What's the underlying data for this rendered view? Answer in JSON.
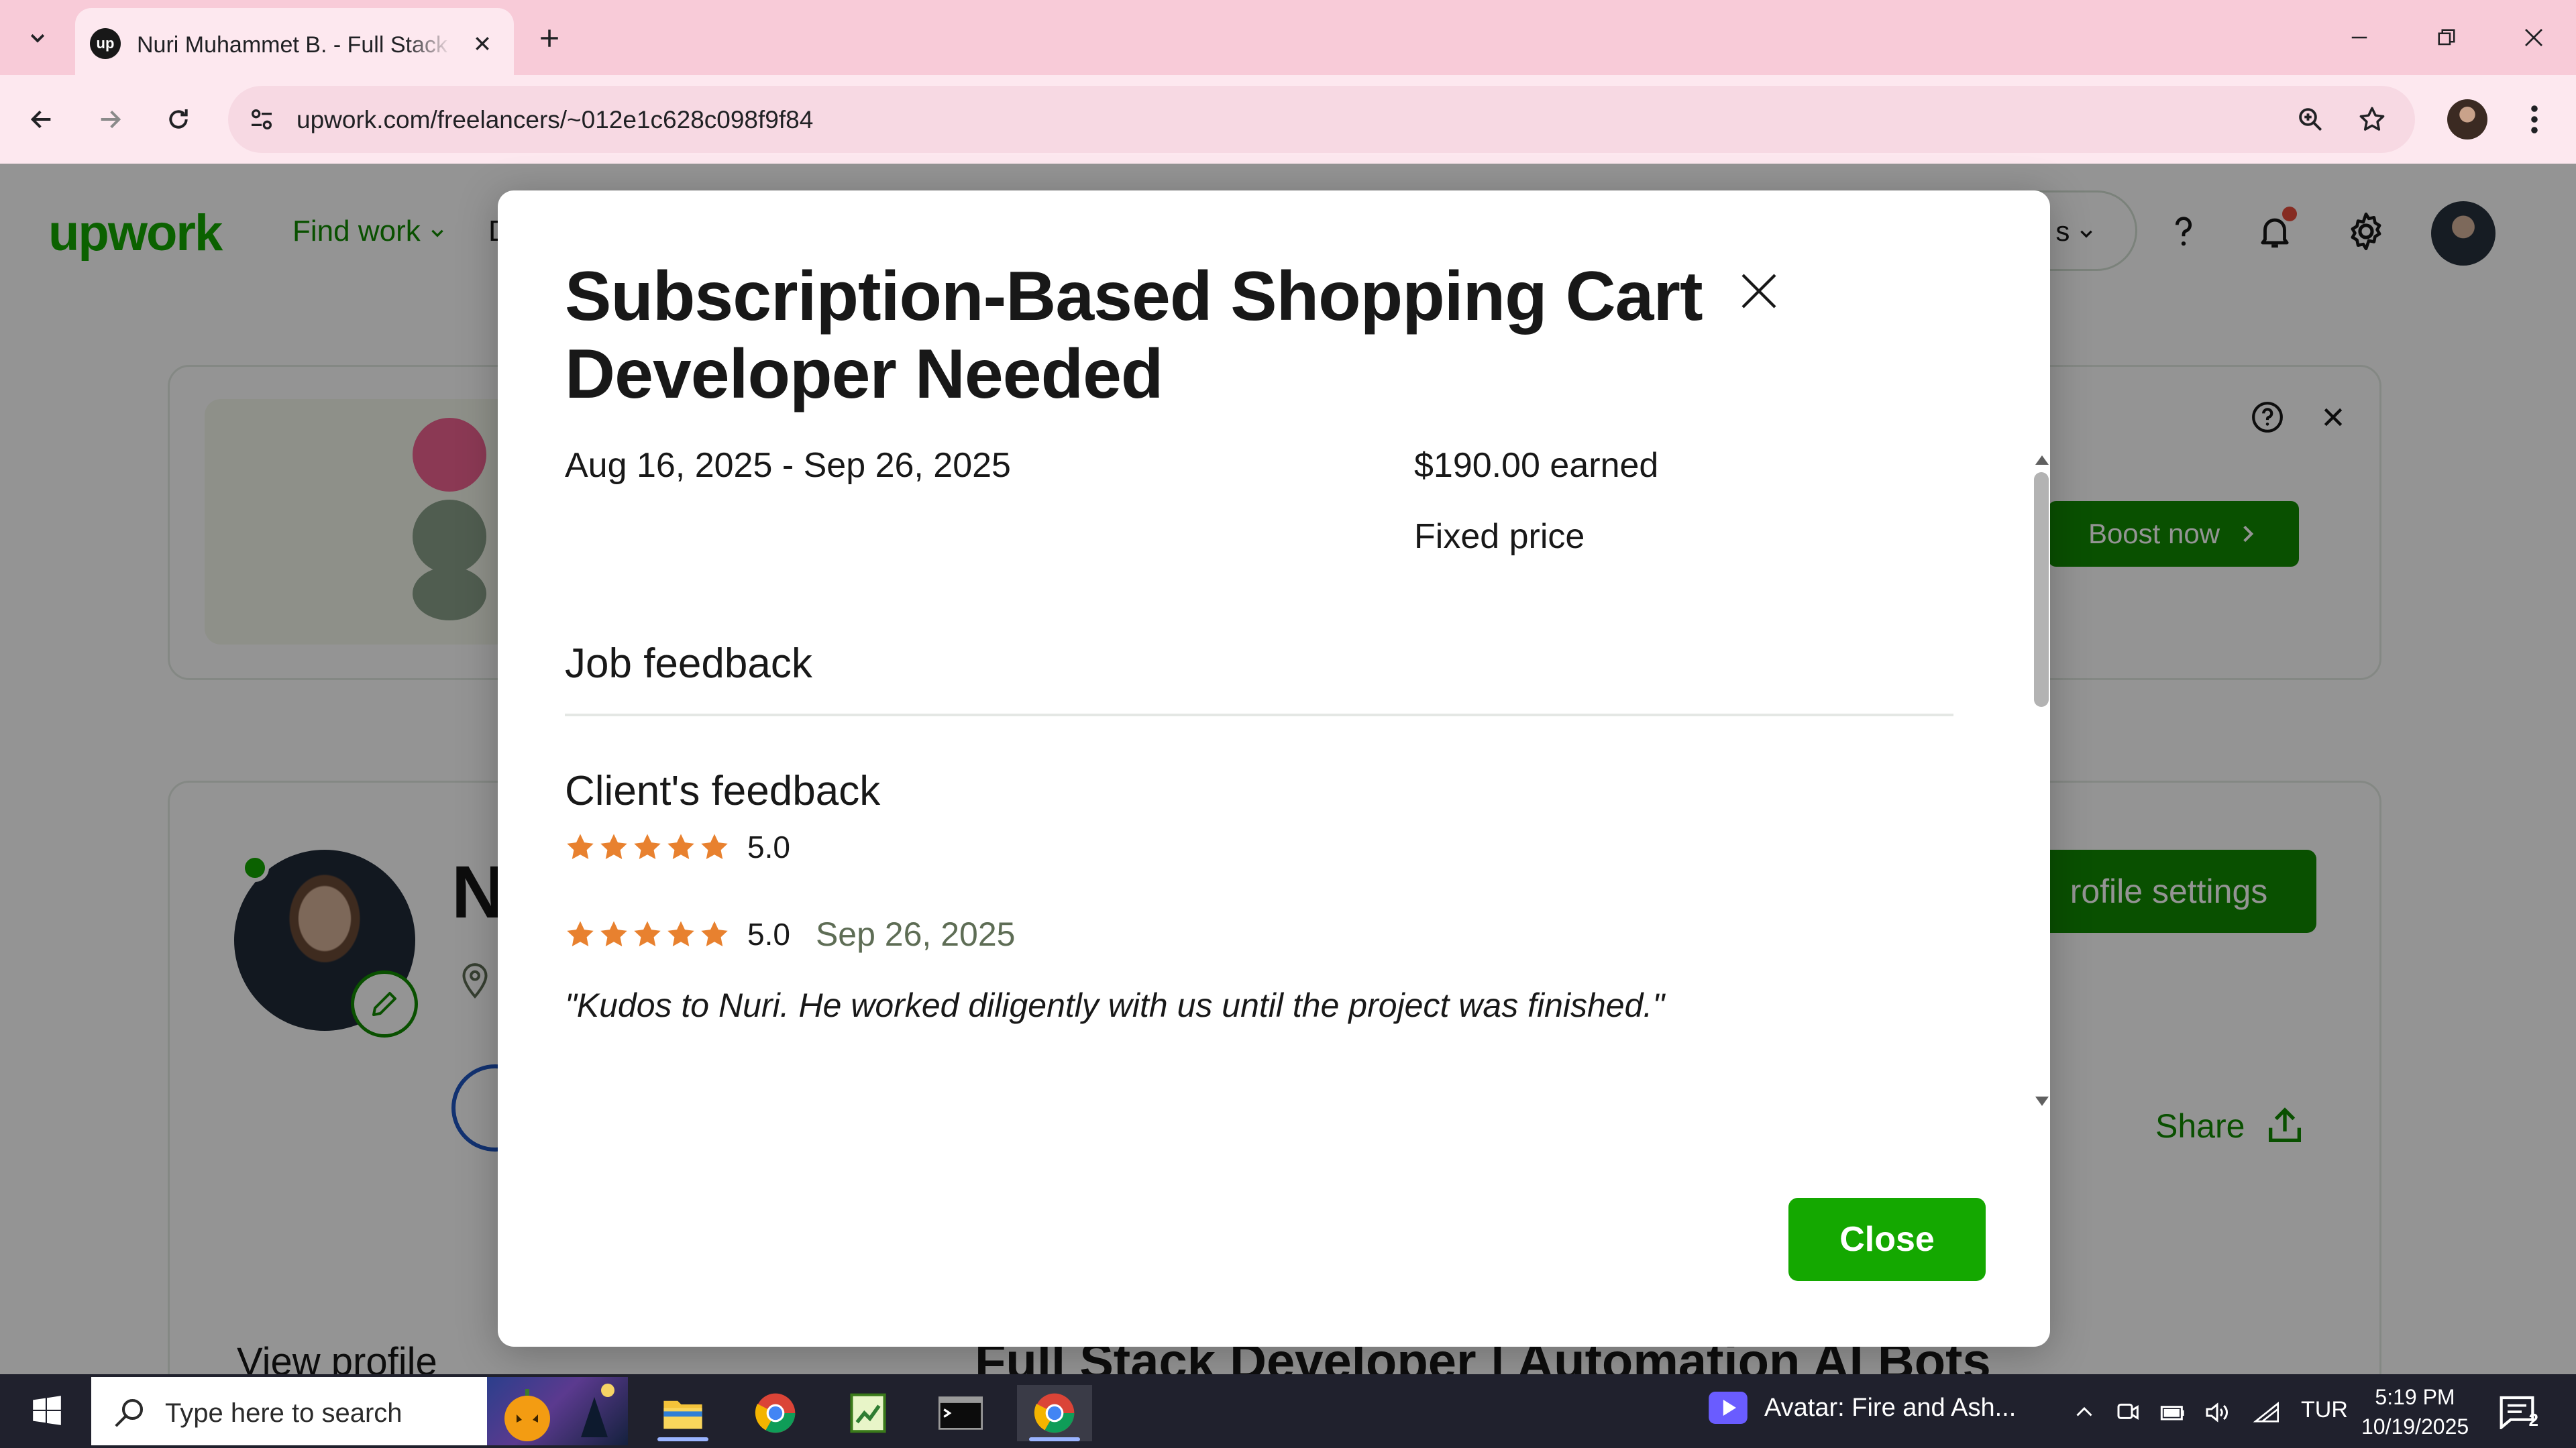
{
  "browser": {
    "tab_title": "Nuri Muhammet B. - Full Stack Developer",
    "favicon_text": "up",
    "url": "upwork.com/freelancers/~012e1c628c098f9f84"
  },
  "page": {
    "logo": "upwork",
    "find_work": "Find work",
    "nav_cut": "D",
    "search_pill_cut": "s",
    "boost_now": "Boost now",
    "profile_name_initial": "N",
    "profile_settings": "rofile settings",
    "share": "Share",
    "view_profile": "View profile",
    "profile_headline_cut": "Full Stack Developer | Automation AI Bots"
  },
  "modal": {
    "title": "Subscription-Based Shopping Cart Developer Needed",
    "dates": "Aug 16, 2025 - Sep 26, 2025",
    "earned": "$190.00 earned",
    "contract_type": "Fixed price",
    "job_feedback_heading": "Job feedback",
    "client_feedback_heading": "Client's feedback",
    "overall_rating": {
      "score": "5.0",
      "stars": 5
    },
    "review": {
      "score": "5.0",
      "stars": 5,
      "date": "Sep 26, 2025",
      "comment": "\"Kudos to Nuri. He worked diligently with us until the project was finished.\""
    },
    "close_label": "Close"
  },
  "taskbar": {
    "search_placeholder": "Type here to search",
    "media_title": "Avatar: Fire and Ash...",
    "language": "TUR",
    "time": "5:19 PM",
    "date": "10/19/2025",
    "notification_count": "2"
  },
  "colors": {
    "upwork_green": "#14a800",
    "upwork_dark_green": "#108a00",
    "star_orange": "#e8812f",
    "tab_bar_pink": "#f8cbd8"
  }
}
